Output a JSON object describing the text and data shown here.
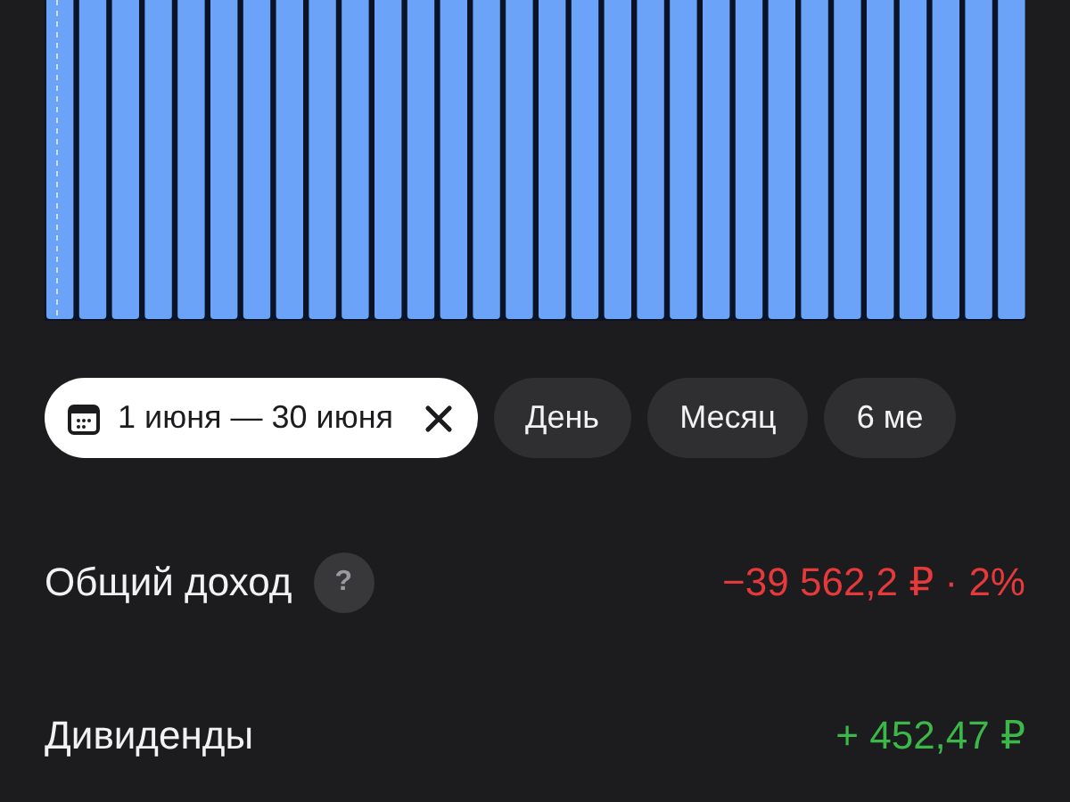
{
  "periods": [
    {
      "label": "1 июня — 30 июня",
      "selected": true,
      "removable": true
    },
    {
      "label": "День",
      "selected": false,
      "removable": false
    },
    {
      "label": "Месяц",
      "selected": false,
      "removable": false
    },
    {
      "label": "6 ме",
      "selected": false,
      "removable": false
    }
  ],
  "summary": [
    {
      "label": "Общий доход",
      "help": "?",
      "value": "−39 562,2 ₽ · 2%",
      "kind": "negative"
    },
    {
      "label": "Дивиденды",
      "value": "+ 452,47 ₽",
      "kind": "positive"
    }
  ]
}
